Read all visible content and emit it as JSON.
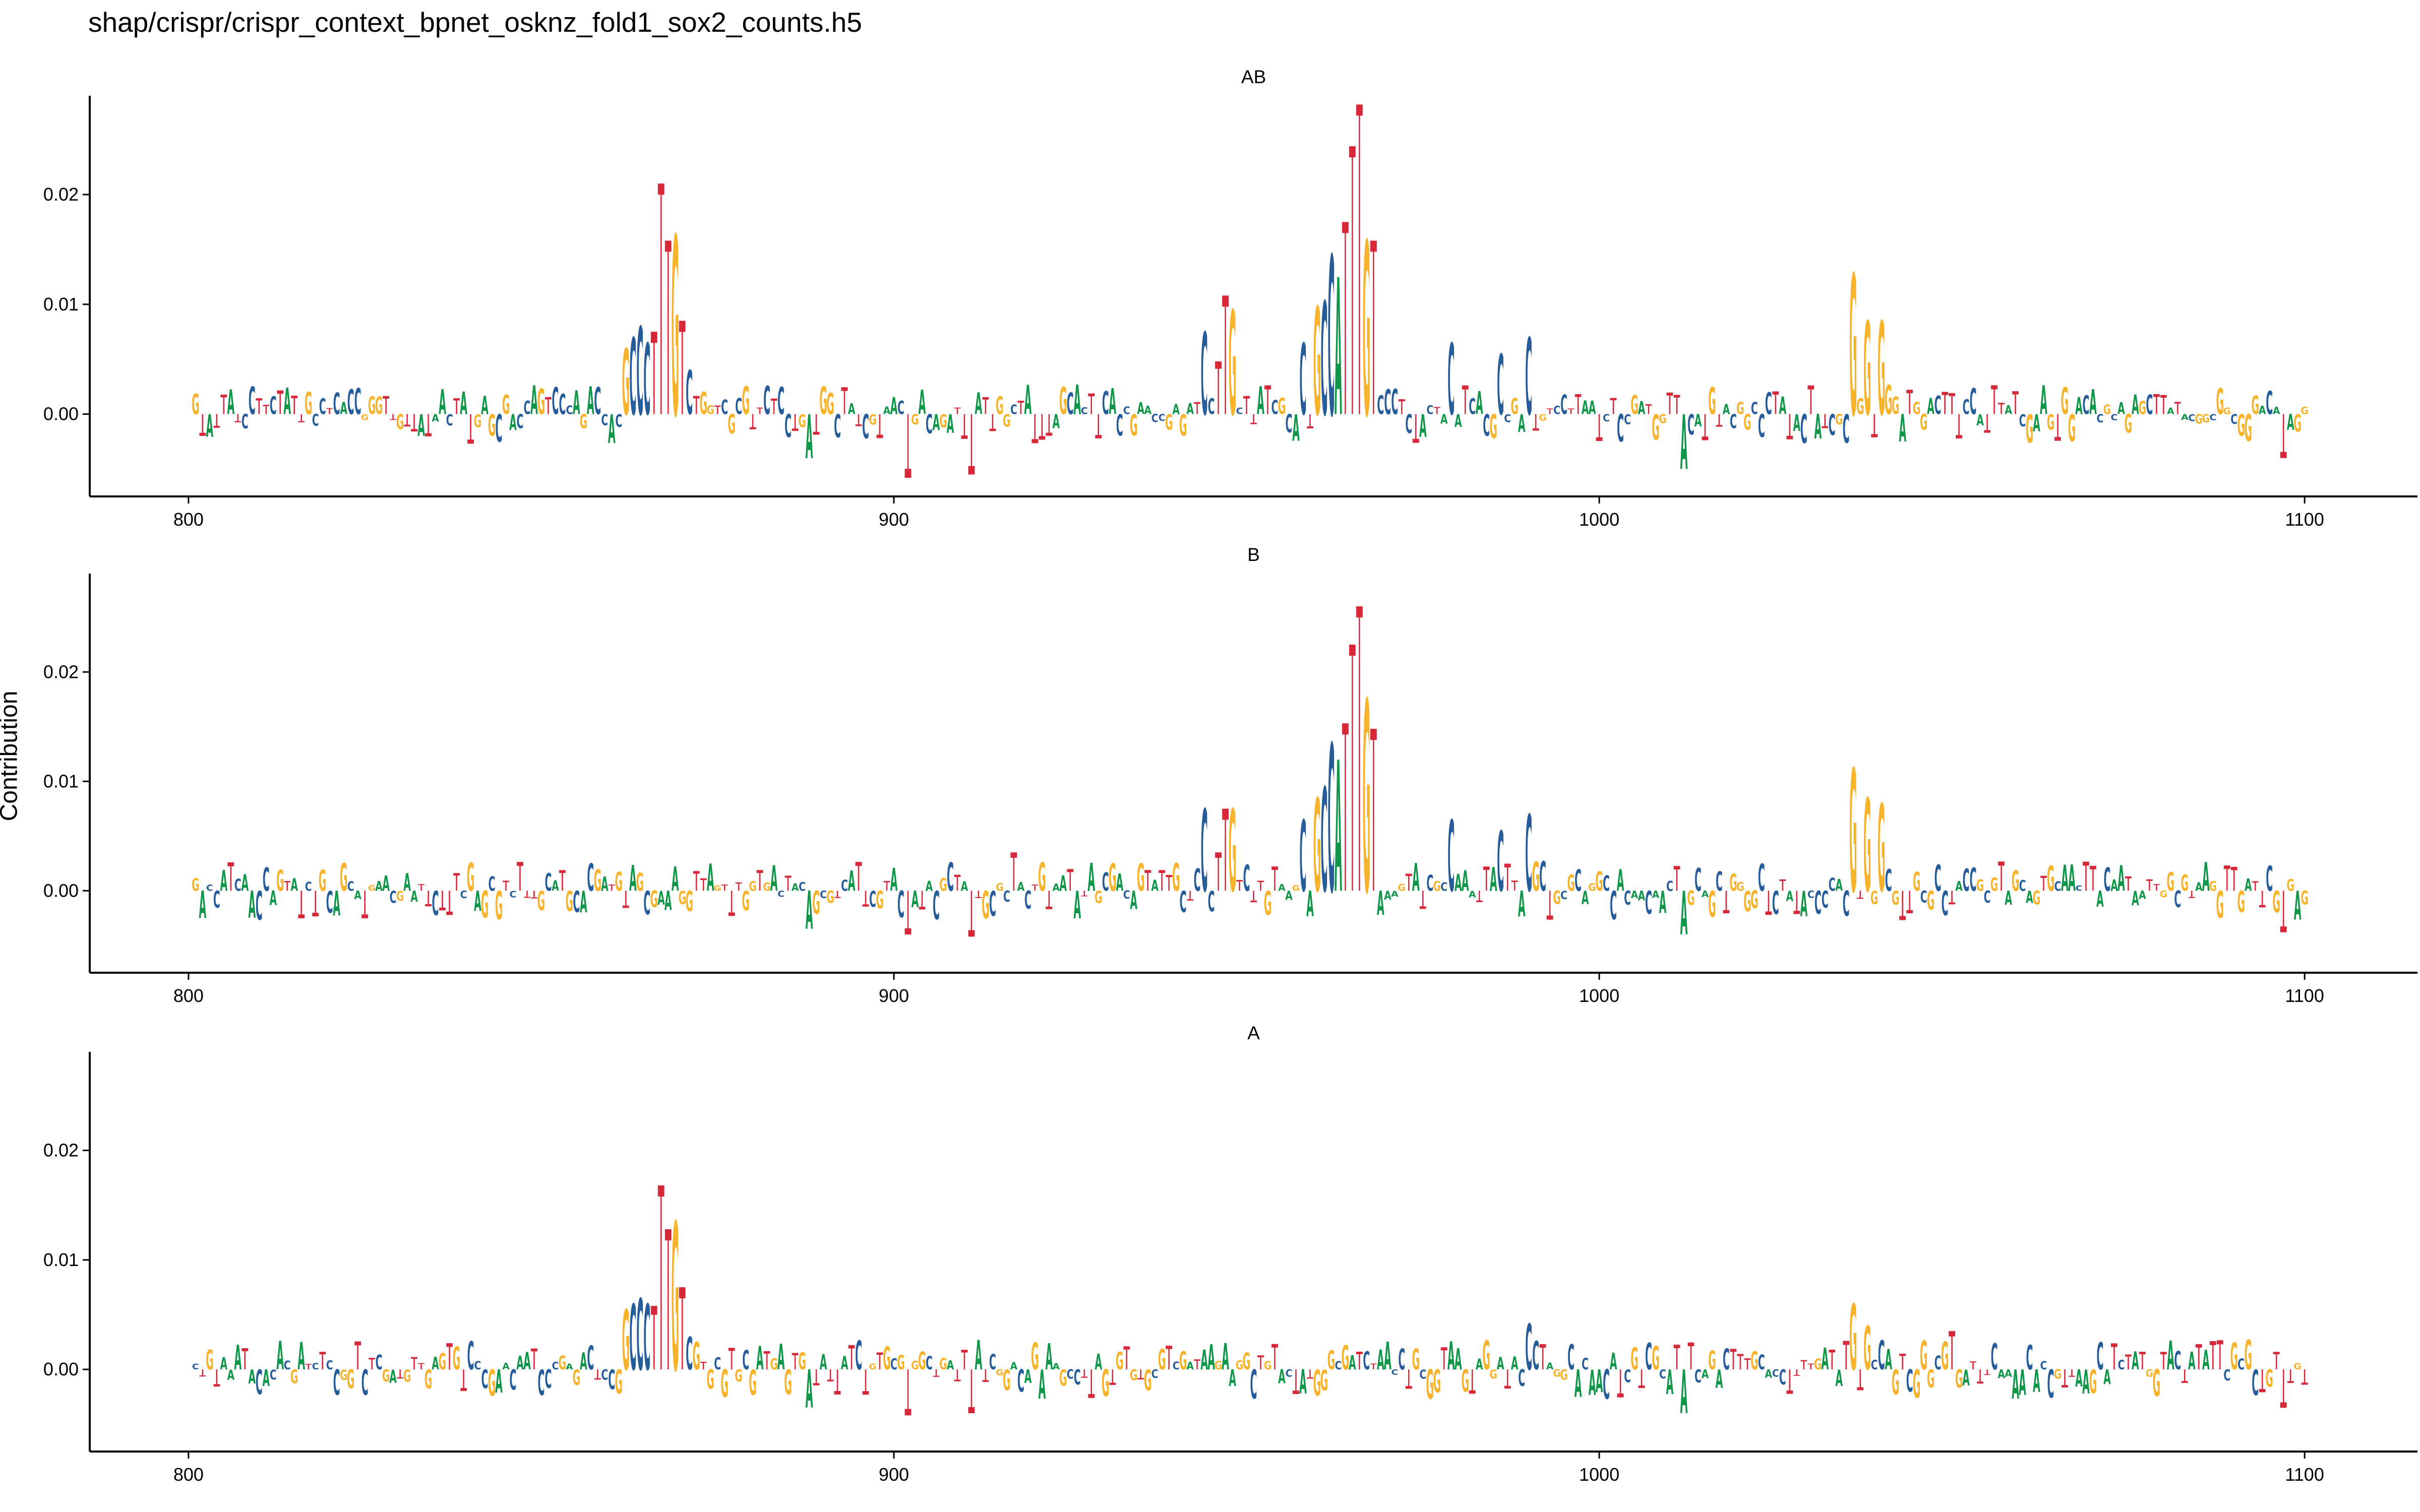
{
  "title": "shap/crispr/crispr_context_bpnet_osknz_fold1_sox2_counts.h5",
  "colors": {
    "A": "#109648",
    "C": "#255C99",
    "G": "#F7B32B",
    "T": "#D62839"
  },
  "chart_data": {
    "type": "sequence-logo",
    "ylabel": "Contribution",
    "xlim": [
      786,
      1116
    ],
    "ylim": [
      -0.0075,
      0.029
    ],
    "xticks": [
      800,
      900,
      1000,
      1100
    ],
    "yticks": [
      0.0,
      0.01,
      0.02
    ],
    "ytick_labels": [
      "0.00",
      "0.01",
      "0.02"
    ],
    "position_range": [
      801,
      1100
    ],
    "panels": [
      {
        "name": "AB",
        "peaks": [
          {
            "pos": 862,
            "base": "G",
            "height": 0.006
          },
          {
            "pos": 863,
            "base": "C",
            "height": 0.007
          },
          {
            "pos": 864,
            "base": "C",
            "height": 0.008
          },
          {
            "pos": 865,
            "base": "C",
            "height": 0.0065
          },
          {
            "pos": 866,
            "base": "T",
            "height": 0.0075
          },
          {
            "pos": 867,
            "base": "T",
            "height": 0.021
          },
          {
            "pos": 868,
            "base": "T",
            "height": 0.0158
          },
          {
            "pos": 869,
            "base": "G",
            "height": 0.0163
          },
          {
            "pos": 870,
            "base": "T",
            "height": 0.0085
          },
          {
            "pos": 871,
            "base": "C",
            "height": 0.004
          },
          {
            "pos": 944,
            "base": "C",
            "height": 0.0075
          },
          {
            "pos": 946,
            "base": "T",
            "height": 0.0048
          },
          {
            "pos": 947,
            "base": "T",
            "height": 0.0108
          },
          {
            "pos": 948,
            "base": "G",
            "height": 0.0095
          },
          {
            "pos": 958,
            "base": "C",
            "height": 0.0065
          },
          {
            "pos": 960,
            "base": "G",
            "height": 0.0098
          },
          {
            "pos": 961,
            "base": "C",
            "height": 0.0103
          },
          {
            "pos": 962,
            "base": "C",
            "height": 0.0145
          },
          {
            "pos": 963,
            "base": "A",
            "height": 0.0125
          },
          {
            "pos": 964,
            "base": "T",
            "height": 0.0175
          },
          {
            "pos": 965,
            "base": "T",
            "height": 0.0244
          },
          {
            "pos": 966,
            "base": "T",
            "height": 0.0282
          },
          {
            "pos": 967,
            "base": "G",
            "height": 0.0158
          },
          {
            "pos": 968,
            "base": "T",
            "height": 0.0158
          },
          {
            "pos": 979,
            "base": "C",
            "height": 0.0065
          },
          {
            "pos": 986,
            "base": "C",
            "height": 0.0055
          },
          {
            "pos": 990,
            "base": "C",
            "height": 0.007
          },
          {
            "pos": 1036,
            "base": "G",
            "height": 0.0128
          },
          {
            "pos": 1038,
            "base": "G",
            "height": 0.0085
          },
          {
            "pos": 1040,
            "base": "G",
            "height": 0.0085
          }
        ],
        "dips": [
          {
            "pos": 888,
            "base": "A",
            "height": -0.004
          },
          {
            "pos": 902,
            "base": "T",
            "height": -0.0058
          },
          {
            "pos": 911,
            "base": "T",
            "height": -0.0055
          },
          {
            "pos": 1012,
            "base": "A",
            "height": -0.005
          },
          {
            "pos": 1097,
            "base": "T",
            "height": -0.004
          }
        ]
      },
      {
        "name": "B",
        "peaks": [
          {
            "pos": 917,
            "base": "T",
            "height": 0.0035
          },
          {
            "pos": 944,
            "base": "C",
            "height": 0.0075
          },
          {
            "pos": 946,
            "base": "T",
            "height": 0.0035
          },
          {
            "pos": 947,
            "base": "T",
            "height": 0.0075
          },
          {
            "pos": 948,
            "base": "G",
            "height": 0.0075
          },
          {
            "pos": 958,
            "base": "C",
            "height": 0.0065
          },
          {
            "pos": 960,
            "base": "G",
            "height": 0.0085
          },
          {
            "pos": 961,
            "base": "C",
            "height": 0.0095
          },
          {
            "pos": 962,
            "base": "C",
            "height": 0.0135
          },
          {
            "pos": 963,
            "base": "A",
            "height": 0.012
          },
          {
            "pos": 964,
            "base": "T",
            "height": 0.0153
          },
          {
            "pos": 965,
            "base": "T",
            "height": 0.0225
          },
          {
            "pos": 966,
            "base": "T",
            "height": 0.026
          },
          {
            "pos": 967,
            "base": "G",
            "height": 0.0175
          },
          {
            "pos": 968,
            "base": "T",
            "height": 0.0148
          },
          {
            "pos": 979,
            "base": "C",
            "height": 0.0065
          },
          {
            "pos": 986,
            "base": "C",
            "height": 0.0055
          },
          {
            "pos": 990,
            "base": "C",
            "height": 0.007
          },
          {
            "pos": 1036,
            "base": "G",
            "height": 0.0112
          },
          {
            "pos": 1038,
            "base": "G",
            "height": 0.0085
          },
          {
            "pos": 1040,
            "base": "G",
            "height": 0.008
          }
        ],
        "dips": [
          {
            "pos": 888,
            "base": "A",
            "height": -0.0035
          },
          {
            "pos": 902,
            "base": "T",
            "height": -0.004
          },
          {
            "pos": 911,
            "base": "T",
            "height": -0.0042
          },
          {
            "pos": 1012,
            "base": "A",
            "height": -0.004
          },
          {
            "pos": 1097,
            "base": "T",
            "height": -0.0038
          }
        ]
      },
      {
        "name": "A",
        "peaks": [
          {
            "pos": 862,
            "base": "G",
            "height": 0.0055
          },
          {
            "pos": 863,
            "base": "C",
            "height": 0.006
          },
          {
            "pos": 864,
            "base": "C",
            "height": 0.0065
          },
          {
            "pos": 865,
            "base": "C",
            "height": 0.006
          },
          {
            "pos": 866,
            "base": "T",
            "height": 0.0058
          },
          {
            "pos": 867,
            "base": "T",
            "height": 0.0168
          },
          {
            "pos": 868,
            "base": "T",
            "height": 0.0128
          },
          {
            "pos": 869,
            "base": "G",
            "height": 0.0135
          },
          {
            "pos": 870,
            "base": "T",
            "height": 0.0075
          },
          {
            "pos": 871,
            "base": "C",
            "height": 0.003
          },
          {
            "pos": 990,
            "base": "C",
            "height": 0.0042
          },
          {
            "pos": 1036,
            "base": "G",
            "height": 0.006
          },
          {
            "pos": 1038,
            "base": "G",
            "height": 0.004
          },
          {
            "pos": 1050,
            "base": "T",
            "height": 0.0035
          }
        ],
        "dips": [
          {
            "pos": 888,
            "base": "A",
            "height": -0.0035
          },
          {
            "pos": 902,
            "base": "T",
            "height": -0.0042
          },
          {
            "pos": 911,
            "base": "T",
            "height": -0.004
          },
          {
            "pos": 1012,
            "base": "A",
            "height": -0.004
          },
          {
            "pos": 1097,
            "base": "T",
            "height": -0.0035
          }
        ]
      }
    ]
  }
}
